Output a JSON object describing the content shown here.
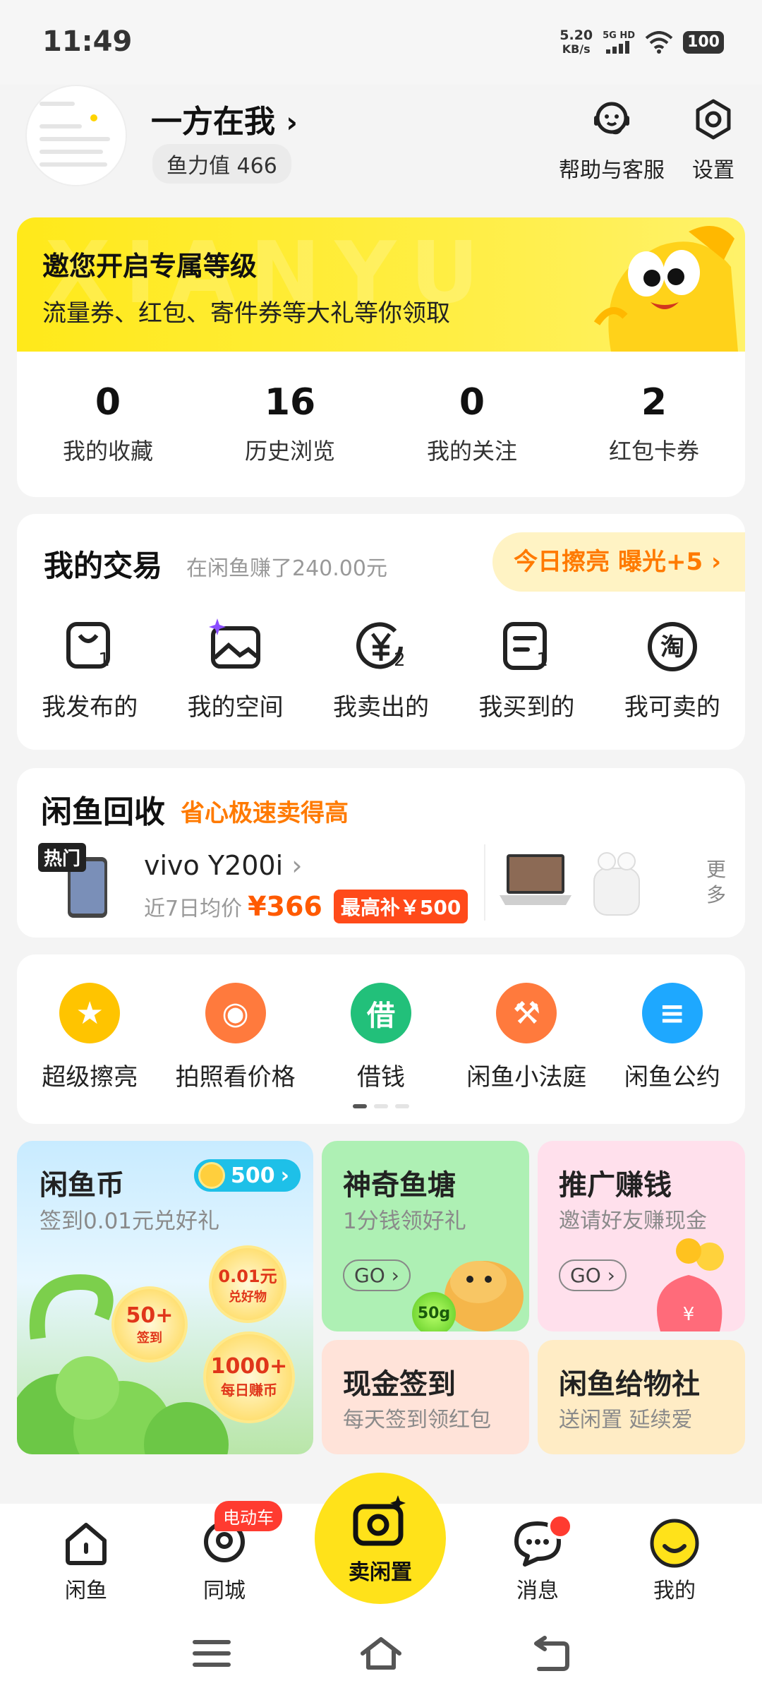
{
  "status": {
    "time": "11:49",
    "net_speed_value": "5.20",
    "net_speed_unit": "KB/s",
    "signal_label": "5G HD",
    "battery": "100"
  },
  "profile": {
    "username": "一方在我",
    "fish_power": "鱼力值 466",
    "help_label": "帮助与客服",
    "settings_label": "设置"
  },
  "level": {
    "title": "邀您开启专属等级",
    "subtitle": "流量券、红包、寄件券等大礼等你领取",
    "watermark": "XIANYU"
  },
  "stats": [
    {
      "value": "0",
      "label": "我的收藏"
    },
    {
      "value": "16",
      "label": "历史浏览"
    },
    {
      "value": "0",
      "label": "我的关注"
    },
    {
      "value": "2",
      "label": "红包卡券"
    }
  ],
  "trade": {
    "title": "我的交易",
    "earn": "在闲鱼赚了240.00元",
    "polish": "今日擦亮 曝光+5",
    "items": [
      {
        "label": "我发布的",
        "badge": "1"
      },
      {
        "label": "我的空间",
        "badge": ""
      },
      {
        "label": "我卖出的",
        "badge": "2"
      },
      {
        "label": "我买到的",
        "badge": "1"
      },
      {
        "label": "我可卖的",
        "badge": ""
      }
    ]
  },
  "recycle": {
    "title": "闲鱼回收",
    "slogan": "省心极速卖得高",
    "hot": "热门",
    "model": "vivo Y200i",
    "price_label": "近7日均价",
    "price": "¥366",
    "max": "最高补￥500",
    "more": "更多"
  },
  "tools": [
    {
      "label": "超级擦亮",
      "glyph": "★",
      "color": "#ffc400"
    },
    {
      "label": "拍照看价格",
      "glyph": "◉",
      "color": "#ff7a3d"
    },
    {
      "label": "借钱",
      "glyph": "借",
      "color": "#22c07a"
    },
    {
      "label": "闲鱼小法庭",
      "glyph": "⚒",
      "color": "#ff7a3d"
    },
    {
      "label": "闲鱼公约",
      "glyph": "≡",
      "color": "#1ea8ff"
    }
  ],
  "tiles": {
    "coin": {
      "title": "闲鱼币",
      "sub": "签到0.01元兑好礼",
      "badge": "500",
      "b1": "0.01元",
      "b1s": "兑好物",
      "b2": "50+",
      "b2s": "签到",
      "b3": "1000+",
      "b3s": "每日赚币"
    },
    "pond": {
      "title": "神奇鱼塘",
      "sub": "1分钱领好礼",
      "go": "GO",
      "bubble": "50g"
    },
    "promo": {
      "title": "推广赚钱",
      "sub": "邀请好友赚现金",
      "go": "GO"
    },
    "cash": {
      "title": "现金签到",
      "sub": "每天签到领红包"
    },
    "gift": {
      "title": "闲鱼给物社",
      "sub": "送闲置 延续爱"
    }
  },
  "nav": {
    "home": "闲鱼",
    "city": "同城",
    "city_badge": "电动车",
    "sell": "卖闲置",
    "messages": "消息",
    "mine": "我的"
  }
}
